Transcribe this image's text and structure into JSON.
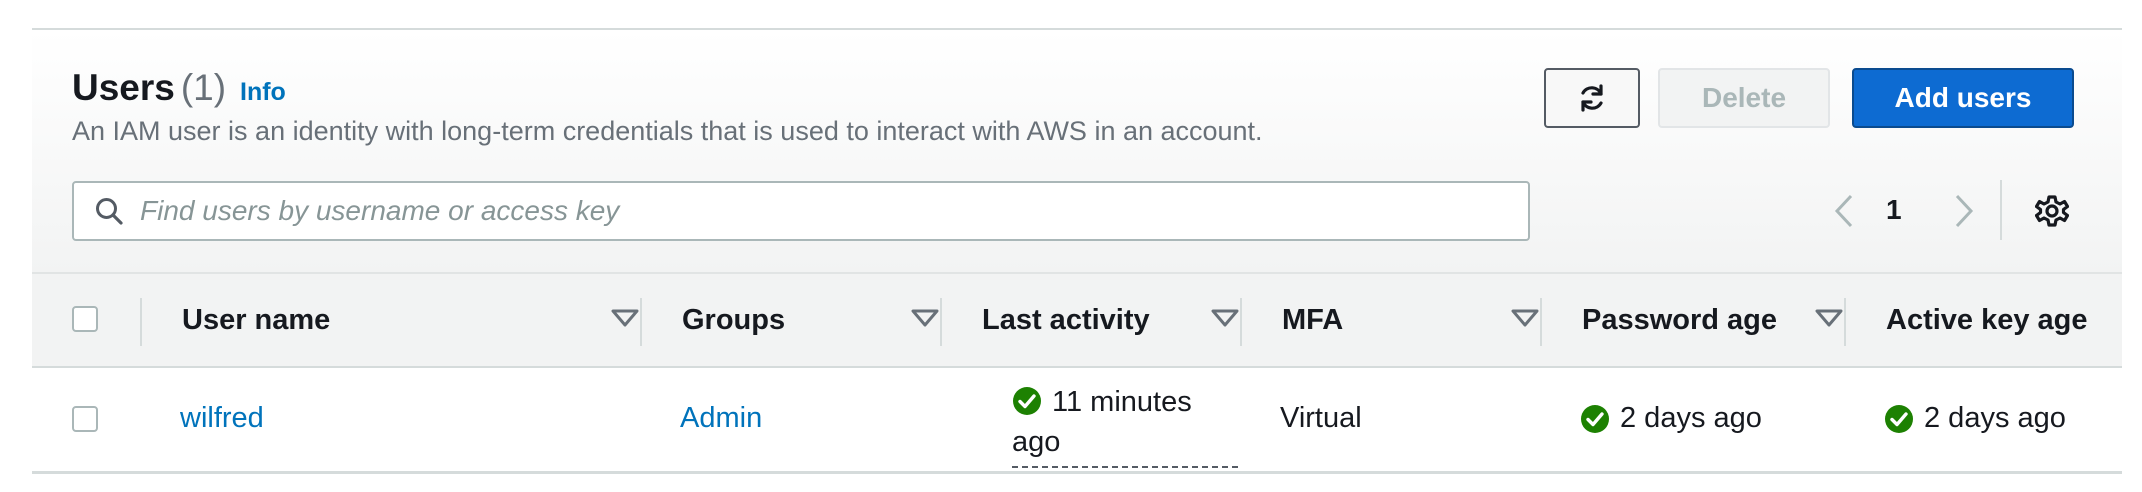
{
  "header": {
    "title": "Users",
    "count": "(1)",
    "info_label": "Info",
    "description": "An IAM user is an identity with long-term credentials that is used to interact with AWS in an account."
  },
  "toolbar": {
    "refresh_icon": "refresh-icon",
    "delete_label": "Delete",
    "add_label": "Add users"
  },
  "search": {
    "placeholder": "Find users by username or access key",
    "value": ""
  },
  "pagination": {
    "page": "1"
  },
  "table": {
    "columns": [
      {
        "label": "User name"
      },
      {
        "label": "Groups"
      },
      {
        "label": "Last activity"
      },
      {
        "label": "MFA"
      },
      {
        "label": "Password age"
      },
      {
        "label": "Active key age"
      }
    ],
    "rows": [
      {
        "user_name": "wilfred",
        "groups": "Admin",
        "last_activity": "11 minutes ago",
        "mfa": "Virtual",
        "password_age": "2 days ago",
        "active_key_age": "2 days ago"
      }
    ]
  },
  "colors": {
    "accent": "#0073bb",
    "primary_button": "#0d6bd2",
    "success": "#1d8102"
  }
}
